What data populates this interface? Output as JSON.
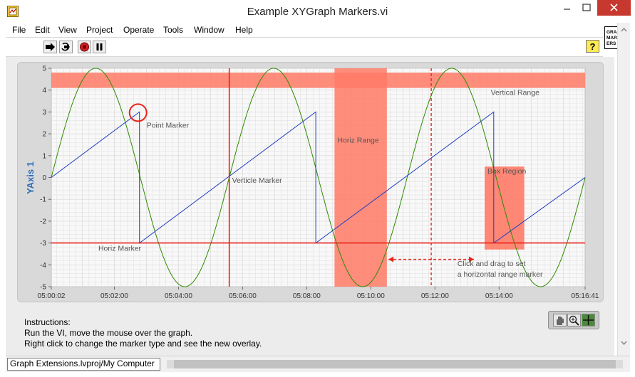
{
  "window": {
    "title": "Example XYGraph Markers.vi",
    "controls": {
      "minimize_icon": "minimize-icon",
      "maximize_icon": "maximize-icon",
      "close_icon": "close-icon"
    }
  },
  "menu": {
    "items": [
      "File",
      "Edit",
      "View",
      "Project",
      "Operate",
      "Tools",
      "Window",
      "Help"
    ]
  },
  "toolbar": {
    "buttons": [
      "run-arrow-icon",
      "run-continuously-icon",
      "abort-icon",
      "pause-icon"
    ],
    "help_label": "?"
  },
  "vi_icon": {
    "lines": [
      "GRAPH",
      "MARK-",
      "ERS"
    ]
  },
  "graph": {
    "ylabel": "YAxis 1",
    "chart_data": {
      "type": "line",
      "ylabel": "YAxis 1",
      "ylim": [
        -5,
        5
      ],
      "y_ticks": [
        "5",
        "4",
        "3",
        "2",
        "1",
        "0",
        "-1",
        "-2",
        "-3",
        "-4",
        "-5"
      ],
      "x_range_seconds": [
        2,
        1001
      ],
      "x_ticks": [
        {
          "t": 2,
          "label": "05:00:02"
        },
        {
          "t": 120,
          "label": "05:02:00"
        },
        {
          "t": 240,
          "label": "05:04:00"
        },
        {
          "t": 360,
          "label": "05:06:00"
        },
        {
          "t": 480,
          "label": "05:08:00"
        },
        {
          "t": 600,
          "label": "05:10:00"
        },
        {
          "t": 720,
          "label": "05:12:00"
        },
        {
          "t": 840,
          "label": "05:14:00"
        },
        {
          "t": 1001,
          "label": "05:16:41"
        }
      ],
      "grid": true,
      "series": [
        {
          "color": "#2e8b00",
          "shape": "sine",
          "amplitude": 5,
          "period_seconds": 333,
          "zero_crossing_seconds": 2
        },
        {
          "color": "#1f3fbf",
          "shape": "sawtooth",
          "points": [
            [
              2,
              0
            ],
            [
              167,
              3
            ],
            [
              167,
              -3
            ],
            [
              497,
              3
            ],
            [
              497,
              -3
            ],
            [
              830,
              3
            ],
            [
              830,
              -3
            ],
            [
              1001,
              0
            ]
          ]
        }
      ],
      "annotations": [
        {
          "type": "horizontal-band",
          "y_from": 4.1,
          "y_to": 4.8,
          "label": "Vertical Range"
        },
        {
          "type": "vertical-band",
          "x_from": 532,
          "x_to": 630,
          "label": "Horiz Range"
        },
        {
          "type": "box",
          "x_from": 813,
          "x_to": 887,
          "y_from": -3.3,
          "y_to": 0.5,
          "label": "Box Region"
        },
        {
          "type": "vertical-line",
          "x": 335,
          "label": "Verticle Marker"
        },
        {
          "type": "horizontal-line",
          "y": -3,
          "label": "Horiz Marker"
        },
        {
          "type": "point",
          "x": 167,
          "y": 3,
          "label": "Point Marker"
        },
        {
          "type": "dashed-vertical",
          "x": 713
        },
        {
          "type": "text",
          "lines": [
            "Click and drag to set",
            "a horizontal range marker"
          ]
        }
      ],
      "colors": {
        "marker": "#e8231b",
        "band": "#ff7a66",
        "plot_bg": "#f8f8f8",
        "grid": "#e2e2e2"
      }
    }
  },
  "instructions": {
    "title": "Instructions:",
    "line1": "Run the VI, move the mouse over the graph.",
    "line2": "Right click to change the marker type and see the new overlay."
  },
  "graph_palette": {
    "buttons": [
      "pan-hand-icon",
      "zoom-icon",
      "cursor-crosshair-icon"
    ]
  },
  "statusbar": {
    "path": "Graph Extensions.lvproj/My Computer"
  }
}
